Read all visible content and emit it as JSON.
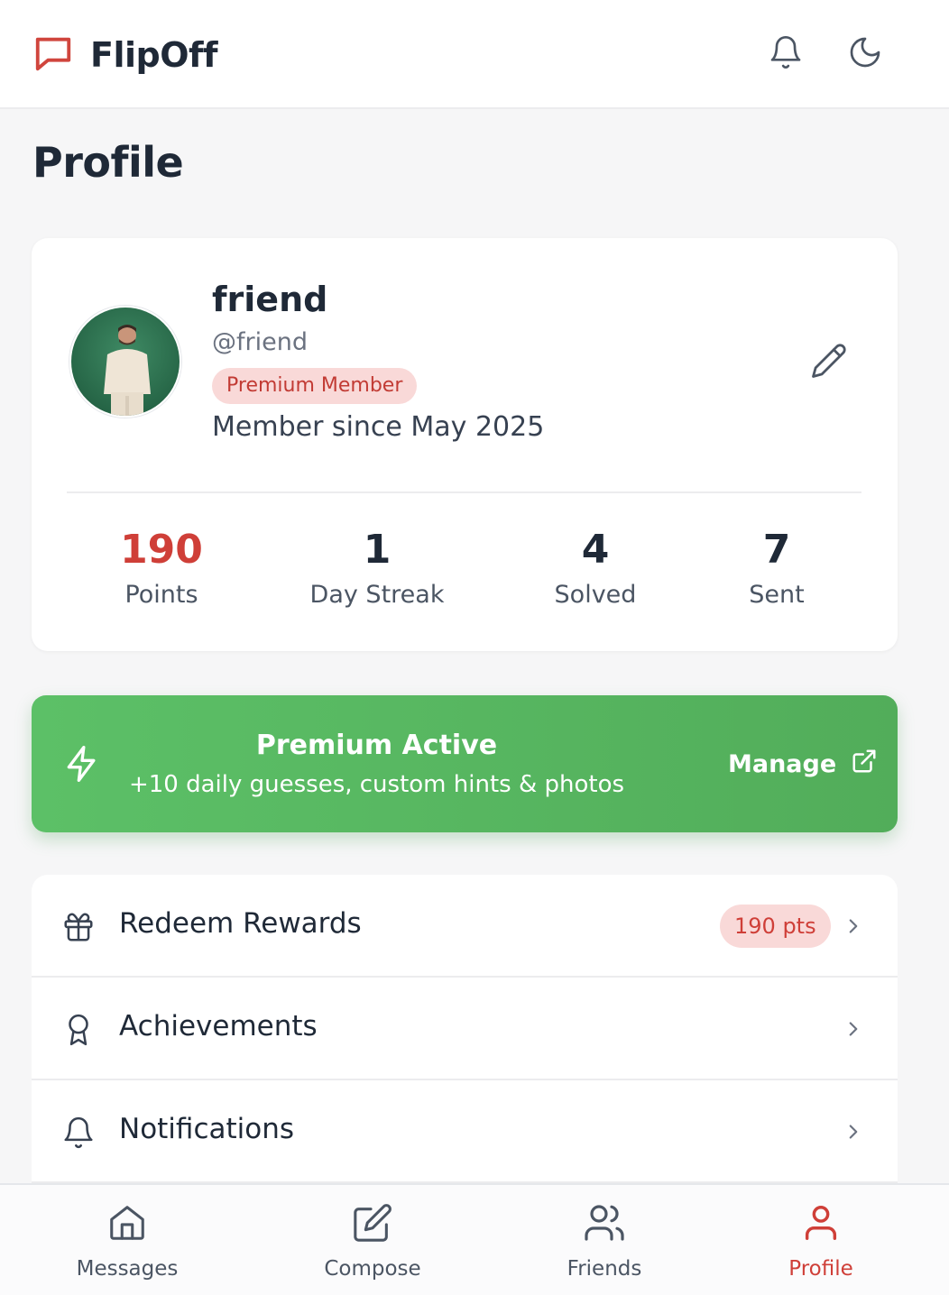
{
  "app": {
    "brand": "FlipOff",
    "accent_color": "#cf3f38",
    "premium_color": "#5cc067"
  },
  "header": {
    "notifications_icon": "bell-icon",
    "theme_icon": "moon-icon"
  },
  "page": {
    "title": "Profile"
  },
  "profile": {
    "name": "friend",
    "handle": "@friend",
    "badge": "Premium Member",
    "member_since": "Member since May 2025",
    "stats": [
      {
        "value": "190",
        "label": "Points"
      },
      {
        "value": "1",
        "label": "Day Streak"
      },
      {
        "value": "4",
        "label": "Solved"
      },
      {
        "value": "7",
        "label": "Sent"
      }
    ]
  },
  "premium": {
    "title": "Premium Active",
    "subtitle": "+10 daily guesses, custom hints & photos",
    "manage_label": "Manage"
  },
  "menu": [
    {
      "label": "Redeem Rewards",
      "icon": "gift-icon",
      "badge": "190 pts"
    },
    {
      "label": "Achievements",
      "icon": "award-icon"
    },
    {
      "label": "Notifications",
      "icon": "bell-icon"
    }
  ],
  "nav": [
    {
      "label": "Messages",
      "icon": "home-icon"
    },
    {
      "label": "Compose",
      "icon": "edit-icon"
    },
    {
      "label": "Friends",
      "icon": "users-icon"
    },
    {
      "label": "Profile",
      "icon": "user-icon",
      "active": true
    }
  ]
}
